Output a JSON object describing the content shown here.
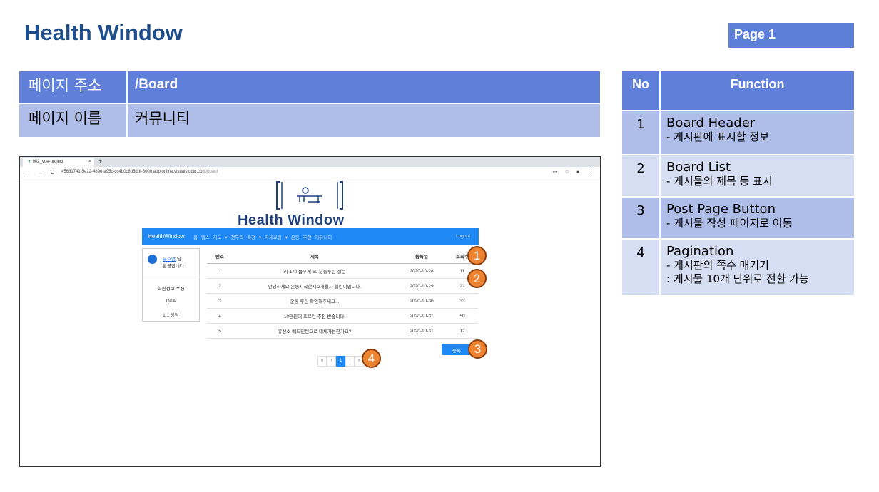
{
  "header": {
    "title": "Health Window",
    "page": "Page 1"
  },
  "info": {
    "address_label": "페이지 주소",
    "address_value": "/Board",
    "name_label": "페이지 이름",
    "name_value": "커뮤니티"
  },
  "functions": {
    "col_no": "No",
    "col_function": "Function",
    "rows": [
      {
        "no": "1",
        "title": "Board Header",
        "desc": [
          "- 게시판에 표시할 정보"
        ]
      },
      {
        "no": "2",
        "title": "Board List",
        "desc": [
          "- 게시물의 제목 등 표시"
        ]
      },
      {
        "no": "3",
        "title": "Post Page Button",
        "desc": [
          "- 게시물 작성 페이지로 이동"
        ]
      },
      {
        "no": "4",
        "title": "Pagination",
        "desc": [
          "- 게시판의 쪽수 매기기",
          ": 게시물 10개 단위로 전환 가능"
        ]
      }
    ]
  },
  "browser": {
    "tab_title": "002_vue-project",
    "tab_close": "×",
    "tab_new": "+",
    "nav_icons": "← → C",
    "url": "45681741-5e22-4890-a95c-cc4b0c8d5ddf-8000.app.online.visualstudio.com",
    "url_path": "/board",
    "right_icons": "⊶ ☆ ● ⋮"
  },
  "app": {
    "logo_text": "Health Window",
    "nav": {
      "brand": "HealthWindow",
      "links": "홈  헬스 지도 ▾  전두력 측정 ▾  자세교정 ▾  운동 추천  커뮤니티",
      "logout": "Logout"
    },
    "sidebar": {
      "user_name": "유호연",
      "user_suffix": " 님",
      "welcome": "환영합니다",
      "menu": [
        "회원정보 수정",
        "Q&A",
        "1:1 상담"
      ]
    },
    "board": {
      "headers": {
        "no": "번호",
        "title": "제목",
        "date": "등록일",
        "views": "조회수"
      },
      "rows": [
        {
          "no": "1",
          "title": "키 170 몸무게 60 운동루틴 질문",
          "date": "2020-10-28",
          "views": "11"
        },
        {
          "no": "2",
          "title": "안녕하세요 운동시작한지 2개월차 헬린이입니다.",
          "date": "2020-10-29",
          "views": "22"
        },
        {
          "no": "3",
          "title": "운동 루틴 확인해주세요...",
          "date": "2020-10-30",
          "views": "33"
        },
        {
          "no": "4",
          "title": "10만원대 프로틴 추천 받습니다.",
          "date": "2020-10-31",
          "views": "50"
        },
        {
          "no": "5",
          "title": "유산소 배드민턴으로 대체가능한가요?",
          "date": "2020-10-31",
          "views": "12"
        }
      ]
    },
    "post_button": "등록",
    "pagination": [
      "«",
      "‹",
      "1",
      "›",
      "»"
    ]
  },
  "markers": [
    "1",
    "2",
    "3",
    "4"
  ]
}
